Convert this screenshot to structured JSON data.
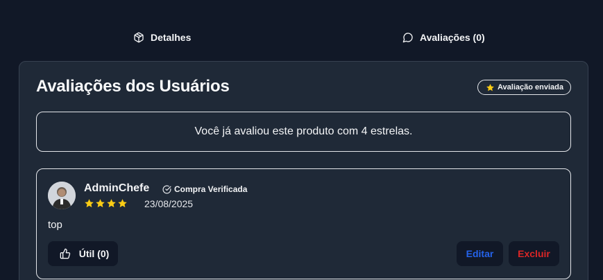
{
  "tabs": [
    {
      "label": "Detalhes",
      "icon": "package-icon"
    },
    {
      "label": "Avaliações (0)",
      "icon": "message-circle-icon"
    }
  ],
  "card": {
    "title": "Avaliações dos Usuários",
    "status_badge": "Avaliação enviada",
    "status_icon": "star-icon",
    "notice": "Você já avaliou este produto com 4 estrelas."
  },
  "review": {
    "author": "AdminChefe",
    "verified_label": "Compra Verificada",
    "rating": 4,
    "date": "23/08/2025",
    "text": "top",
    "helpful_label": "Útil (0)",
    "edit_label": "Editar",
    "delete_label": "Excluir"
  },
  "colors": {
    "background": "#111827",
    "card": "#1f2937",
    "star": "#facc15",
    "edit": "#2563eb",
    "delete": "#dc2626"
  }
}
